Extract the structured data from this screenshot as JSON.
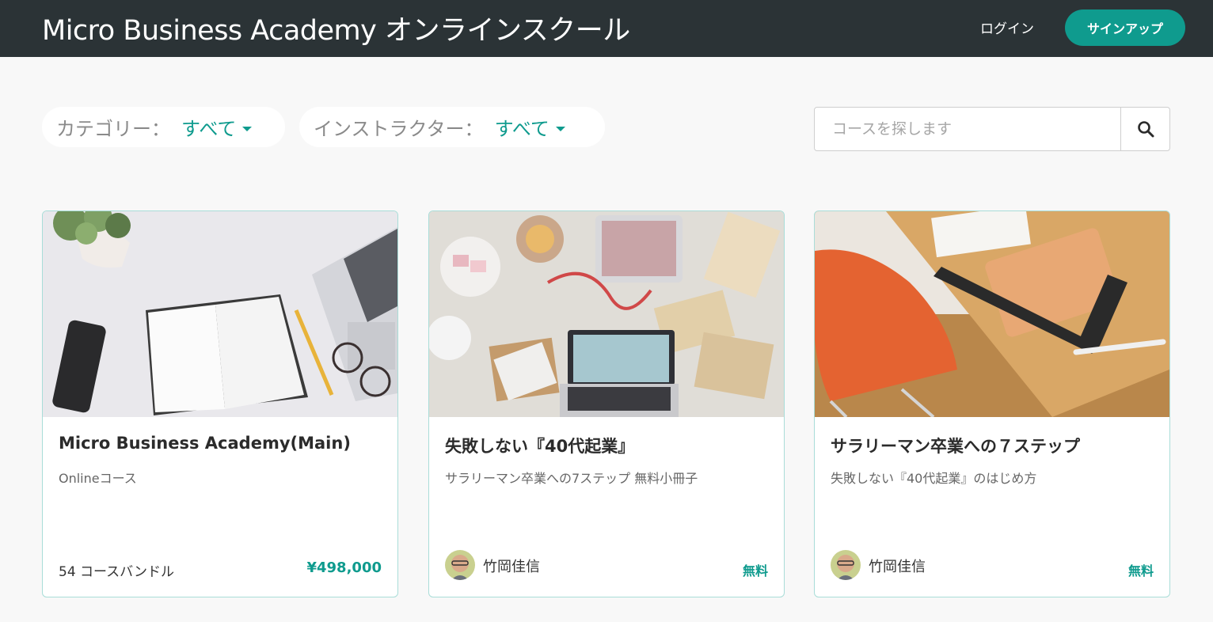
{
  "header": {
    "brand": "Micro Business Academy オンラインスクール",
    "login": "ログイン",
    "signup": "サインアップ"
  },
  "filters": {
    "category_label": "カテゴリー：",
    "category_value": "すべて",
    "instructor_label": "インストラクター：",
    "instructor_value": "すべて"
  },
  "search": {
    "placeholder": "コースを探します",
    "icon": "search-icon"
  },
  "courses": [
    {
      "title": "Micro Business Academy(Main)",
      "subtitle": "Onlineコース",
      "bundle": "54 コースバンドル",
      "price": "¥498,000",
      "image": "desk-notebook-laptop"
    },
    {
      "title": "失敗しない『40代起業』",
      "subtitle": "サラリーマン卒業への7ステップ 無料小冊子",
      "instructor": "竹岡佳信",
      "price": "無料",
      "image": "crafts-laptop-desk"
    },
    {
      "title": "サラリーマン卒業への７ステップ",
      "subtitle": "失敗しない『40代起業』のはじめ方",
      "instructor": "竹岡佳信",
      "price": "無料",
      "image": "wooden-table-orange-chair"
    }
  ],
  "colors": {
    "header_bg": "#2b3336",
    "accent": "#0f9b8e",
    "page_bg": "#f8f8f8",
    "card_border": "#a9ddd8"
  }
}
